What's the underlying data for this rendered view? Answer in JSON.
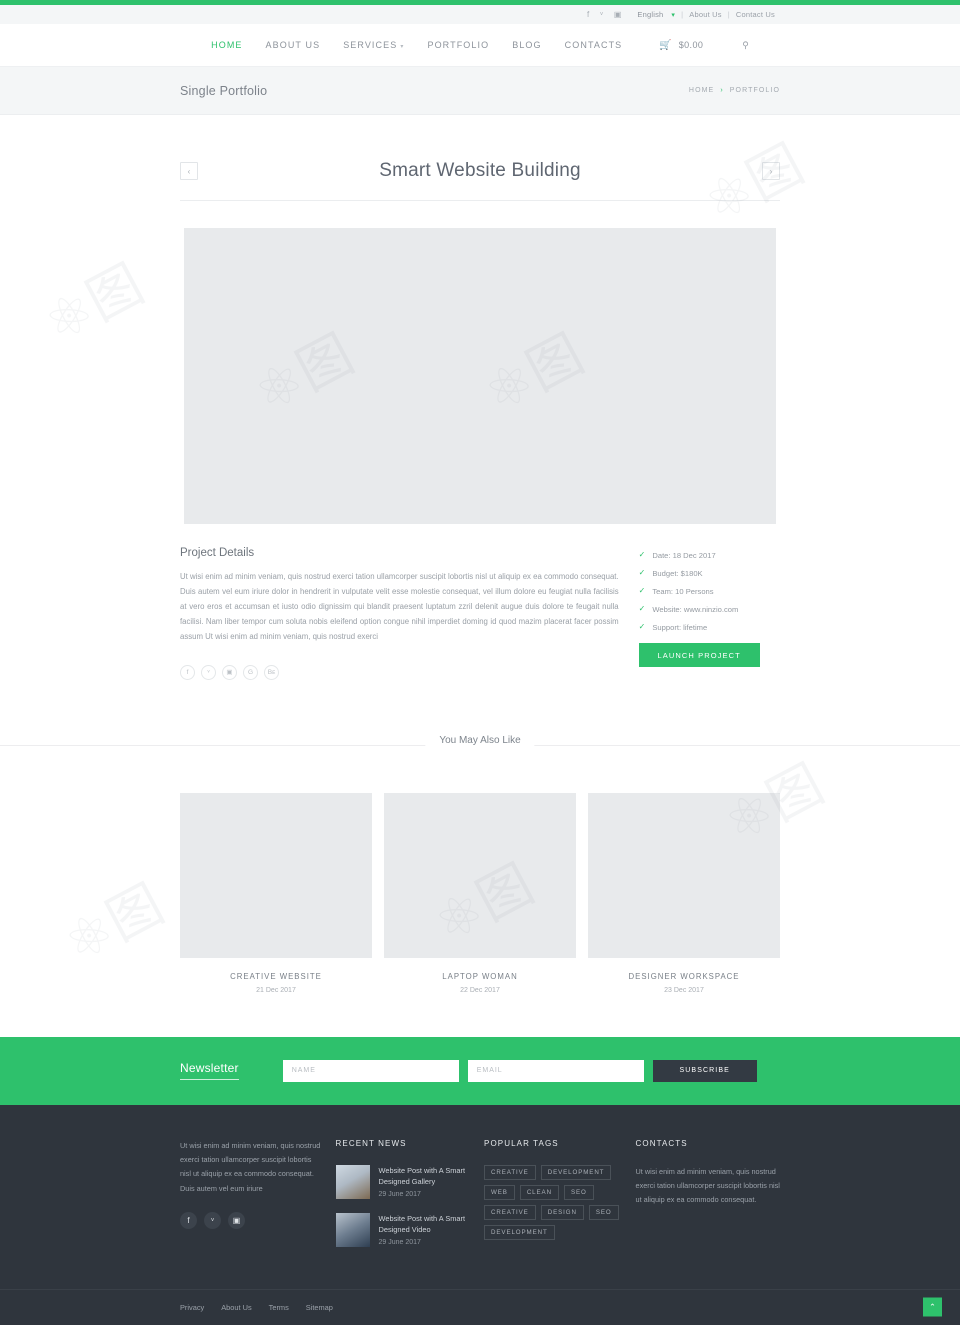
{
  "colors": {
    "accent": "#2ec16c",
    "footer_bg": "#2f353d",
    "placeholder": "#e8eaec",
    "dark_button": "#333a43"
  },
  "topbar": {
    "social": [
      {
        "name": "facebook-icon",
        "glyph": "f"
      },
      {
        "name": "twitter-icon",
        "glyph": "ᵛ"
      },
      {
        "name": "instagram-icon",
        "glyph": "▣"
      }
    ],
    "language": "English",
    "links": [
      "About Us",
      "Contact Us"
    ],
    "separator": "|"
  },
  "nav": {
    "items": [
      {
        "label": "HOME",
        "active": true,
        "caret": false
      },
      {
        "label": "ABOUT US",
        "active": false,
        "caret": false
      },
      {
        "label": "SERVICES",
        "active": false,
        "caret": true
      },
      {
        "label": "PORTFOLIO",
        "active": false,
        "caret": false
      },
      {
        "label": "BLOG",
        "active": false,
        "caret": false
      },
      {
        "label": "CONTACTS",
        "active": false,
        "caret": false
      }
    ],
    "cart_amount": "$0.00",
    "cart_icon": "cart-icon",
    "search_icon": "search-icon"
  },
  "breadcrumb": {
    "page_title": "Single Portfolio",
    "items": [
      "HOME",
      "PORTFOLIO"
    ],
    "arrow": "›"
  },
  "portfolio": {
    "title": "Smart Website Building",
    "prev_label": "‹",
    "next_label": "›"
  },
  "details": {
    "heading": "Project Details",
    "body": "Ut wisi enim ad minim veniam, quis nostrud exerci tation ullamcorper suscipit lobortis nisl ut aliquip ex ea commodo consequat. Duis autem vel eum iriure dolor in hendrerit in vulputate velit esse molestie consequat, vel illum dolore eu feugiat nulla facilisis at vero eros et accumsan et iusto odio dignissim qui blandit praesent luptatum zzril delenit augue duis dolore te feugait nulla facilisi. Nam liber tempor cum soluta nobis eleifend option congue nihil imperdiet doming id quod mazim placerat facer possim assum Ut wisi enim ad minim veniam, quis nostrud exerci",
    "share": [
      {
        "name": "facebook-share-icon",
        "glyph": "f"
      },
      {
        "name": "twitter-share-icon",
        "glyph": "ᵛ"
      },
      {
        "name": "instagram-share-icon",
        "glyph": "▣"
      },
      {
        "name": "google-plus-share-icon",
        "glyph": "G"
      },
      {
        "name": "behance-share-icon",
        "glyph": "Bᴇ"
      }
    ],
    "meta": [
      "Date: 18 Dec 2017",
      "Budget: $180K",
      "Team: 10 Persons",
      "Website: www.ninzio.com",
      "Support: lifetime"
    ],
    "check_glyph": "✓",
    "launch_label": "LAUNCH PROJECT"
  },
  "also_like": {
    "heading": "You May Also Like",
    "items": [
      {
        "title": "CREATIVE WEBSITE",
        "date": "21 Dec 2017"
      },
      {
        "title": "LAPTOP WOMAN",
        "date": "22 Dec 2017"
      },
      {
        "title": "DESIGNER WORKSPACE",
        "date": "23 Dec 2017"
      }
    ]
  },
  "newsletter": {
    "title": "Newsletter",
    "name_placeholder": "NAME",
    "name_value": "",
    "email_placeholder": "EMAIL",
    "email_value": "",
    "subscribe_label": "SUBSCRIBE"
  },
  "footer": {
    "about": {
      "text": "Ut wisi enim ad minim veniam, quis nostrud exerci tation ullamcorper suscipit lobortis nisl ut aliquip ex ea commodo consequat. Duis autem vel eum iriure",
      "social": [
        {
          "name": "facebook-icon",
          "glyph": "f"
        },
        {
          "name": "twitter-icon",
          "glyph": "ᵛ"
        },
        {
          "name": "instagram-icon",
          "glyph": "▣"
        }
      ]
    },
    "recent_news": {
      "heading": "RECENT NEWS",
      "items": [
        {
          "title": "Website Post with A Smart Designed Gallery",
          "date": "29 June 2017"
        },
        {
          "title": "Website Post with A Smart Designed Video",
          "date": "29 June 2017"
        }
      ]
    },
    "popular_tags": {
      "heading": "POPULAR TAGS",
      "tags": [
        "CREATIVE",
        "DEVELOPMENT",
        "WEB",
        "CLEAN",
        "SEO",
        "CREATIVE",
        "DESIGN",
        "SEO",
        "DEVELOPMENT"
      ]
    },
    "contacts": {
      "heading": "CONTACTS",
      "text": "Ut wisi enim ad minim veniam, quis nostrud exerci tation ullamcorper suscipit lobortis nisl ut aliquip ex ea commodo consequat."
    },
    "bottom_links": [
      "Privacy",
      "About Us",
      "Terms",
      "Sitemap"
    ],
    "to_top_glyph": "⌃"
  }
}
